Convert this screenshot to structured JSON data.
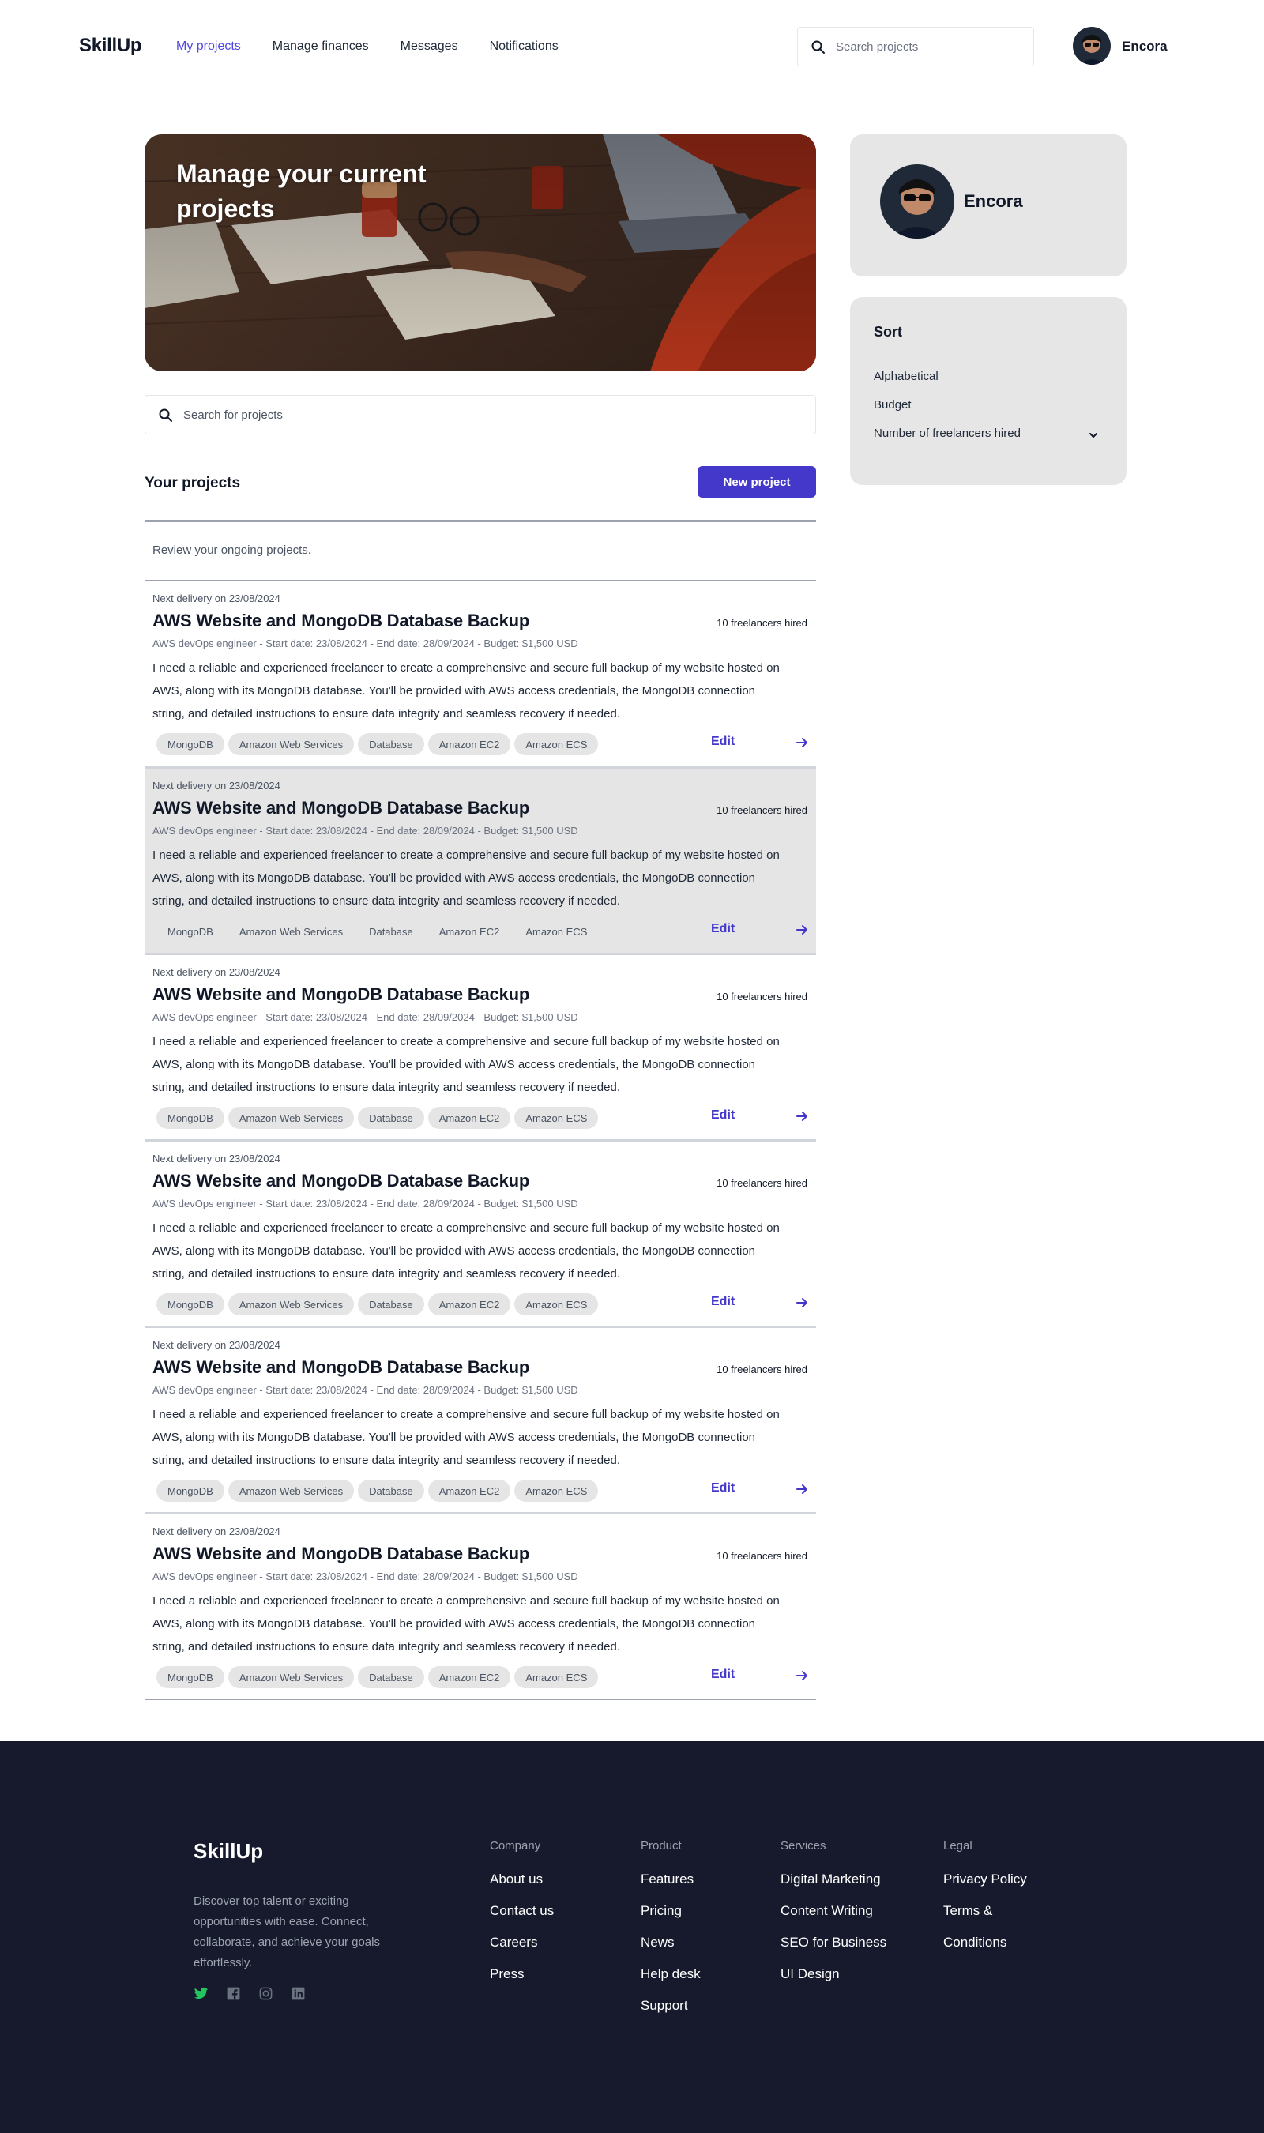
{
  "nav": {
    "logo": "SkillUp",
    "links": [
      "My projects",
      "Manage finances",
      "Messages",
      "Notifications"
    ],
    "search_placeholder": "Search projects",
    "user_name": "Encora"
  },
  "hero": {
    "title": "Manage your current projects"
  },
  "main": {
    "search_placeholder": "Search for projects",
    "projects_title": "Your projects",
    "new_project_label": "New project",
    "subtitle": "Review your ongoing projects.",
    "projects": [
      {
        "delivery": "Next delivery on 23/08/2024",
        "title": "AWS Website and MongoDB Database Backup",
        "hired": "10 freelancers hired",
        "meta": "AWS devOps engineer - Start date: 23/08/2024 - End date: 28/09/2024 - Budget: $1,500 USD",
        "description": "I need a reliable and experienced freelancer to create a comprehensive and secure full backup of my website hosted on AWS, along with its MongoDB database. You'll be provided with AWS access credentials, the MongoDB connection string, and detailed instructions to ensure data integrity and seamless recovery if needed.",
        "tags": [
          "MongoDB",
          "Amazon Web Services",
          "Database",
          "Amazon EC2",
          "Amazon ECS"
        ],
        "edit": "Edit"
      },
      {
        "delivery": "Next delivery on 23/08/2024",
        "title": "AWS Website and MongoDB Database Backup",
        "hired": "10 freelancers hired",
        "meta": "AWS devOps engineer - Start date: 23/08/2024 - End date: 28/09/2024 - Budget: $1,500 USD",
        "description": "I need a reliable and experienced freelancer to create a comprehensive and secure full backup of my website hosted on AWS, along with its MongoDB database. You'll be provided with AWS access credentials, the MongoDB connection string, and detailed instructions to ensure data integrity and seamless recovery if needed.",
        "tags": [
          "MongoDB",
          "Amazon Web Services",
          "Database",
          "Amazon EC2",
          "Amazon ECS"
        ],
        "edit": "Edit"
      },
      {
        "delivery": "Next delivery on 23/08/2024",
        "title": "AWS Website and MongoDB Database Backup",
        "hired": "10 freelancers hired",
        "meta": "AWS devOps engineer - Start date: 23/08/2024 - End date: 28/09/2024 - Budget: $1,500 USD",
        "description": "I need a reliable and experienced freelancer to create a comprehensive and secure full backup of my website hosted on AWS, along with its MongoDB database. You'll be provided with AWS access credentials, the MongoDB connection string, and detailed instructions to ensure data integrity and seamless recovery if needed.",
        "tags": [
          "MongoDB",
          "Amazon Web Services",
          "Database",
          "Amazon EC2",
          "Amazon ECS"
        ],
        "edit": "Edit"
      },
      {
        "delivery": "Next delivery on 23/08/2024",
        "title": "AWS Website and MongoDB Database Backup",
        "hired": "10 freelancers hired",
        "meta": "AWS devOps engineer - Start date: 23/08/2024 - End date: 28/09/2024 - Budget: $1,500 USD",
        "description": "I need a reliable and experienced freelancer to create a comprehensive and secure full backup of my website hosted on AWS, along with its MongoDB database. You'll be provided with AWS access credentials, the MongoDB connection string, and detailed instructions to ensure data integrity and seamless recovery if needed.",
        "tags": [
          "MongoDB",
          "Amazon Web Services",
          "Database",
          "Amazon EC2",
          "Amazon ECS"
        ],
        "edit": "Edit"
      },
      {
        "delivery": "Next delivery on 23/08/2024",
        "title": "AWS Website and MongoDB Database Backup",
        "hired": "10 freelancers hired",
        "meta": "AWS devOps engineer - Start date: 23/08/2024 - End date: 28/09/2024 - Budget: $1,500 USD",
        "description": "I need a reliable and experienced freelancer to create a comprehensive and secure full backup of my website hosted on AWS, along with its MongoDB database. You'll be provided with AWS access credentials, the MongoDB connection string, and detailed instructions to ensure data integrity and seamless recovery if needed.",
        "tags": [
          "MongoDB",
          "Amazon Web Services",
          "Database",
          "Amazon EC2",
          "Amazon ECS"
        ],
        "edit": "Edit"
      },
      {
        "delivery": "Next delivery on 23/08/2024",
        "title": "AWS Website and MongoDB Database Backup",
        "hired": "10 freelancers hired",
        "meta": "AWS devOps engineer - Start date: 23/08/2024 - End date: 28/09/2024 - Budget: $1,500 USD",
        "description": "I need a reliable and experienced freelancer to create a comprehensive and secure full backup of my website hosted on AWS, along with its MongoDB database. You'll be provided with AWS access credentials, the MongoDB connection string, and detailed instructions to ensure data integrity and seamless recovery if needed.",
        "tags": [
          "MongoDB",
          "Amazon Web Services",
          "Database",
          "Amazon EC2",
          "Amazon ECS"
        ],
        "edit": "Edit"
      }
    ]
  },
  "sidebar": {
    "profile_name": "Encora",
    "sort_title": "Sort",
    "sort_options": [
      "Alphabetical",
      "Budget",
      "Number of freelancers hired"
    ]
  },
  "footer": {
    "logo": "SkillUp",
    "blurb": "Discover top talent or exciting opportunities with ease. Connect, collaborate, and achieve your goals effortlessly.",
    "social_icons": [
      "twitter-icon",
      "facebook-icon",
      "instagram-icon",
      "linkedin-icon"
    ],
    "columns": [
      {
        "heading": "Company",
        "links": [
          "About us",
          "Contact us",
          "Careers",
          "Press"
        ]
      },
      {
        "heading": "Product",
        "links": [
          "Features",
          "Pricing",
          "News",
          "Help desk",
          "Support"
        ]
      },
      {
        "heading": "Services",
        "links": [
          "Digital Marketing",
          "Content Writing",
          "SEO for Business",
          "UI Design"
        ]
      },
      {
        "heading": "Legal",
        "links": [
          "Privacy Policy",
          "Terms &",
          "Conditions"
        ]
      }
    ]
  },
  "colors": {
    "accent": "#4338ca",
    "nav_active": "#4f46e5",
    "footer_bg": "#161a2c",
    "card_bg": "#e6e6e6",
    "twitter_green": "#22c55e"
  }
}
